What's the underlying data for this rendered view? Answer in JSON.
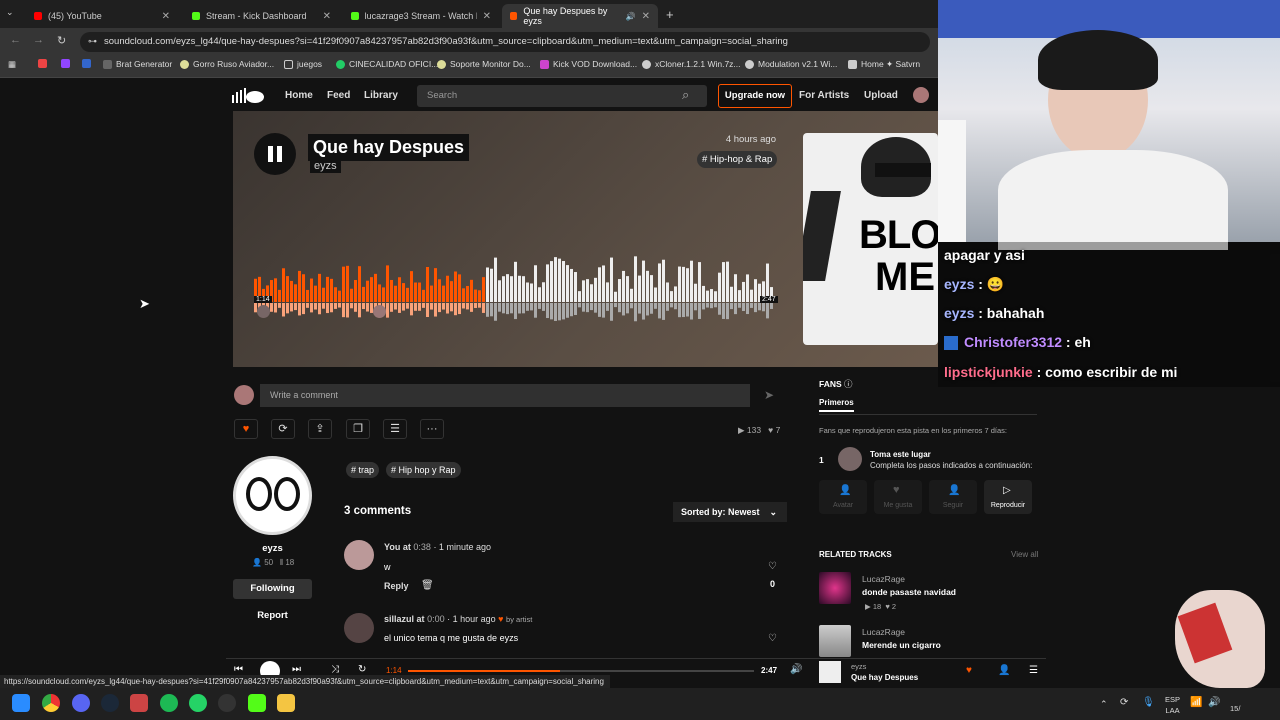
{
  "browser": {
    "tabs": [
      {
        "label": "(45) YouTube"
      },
      {
        "label": "Stream - Kick Dashboard"
      },
      {
        "label": "lucazrage3 Stream - Watch Live"
      },
      {
        "label": "Que hay Despues by eyzs"
      }
    ],
    "url": "soundcloud.com/eyzs_lg44/que-hay-despues?si=41f29f0907a84237957ab82d3f90a93f&utm_source=clipboard&utm_medium=text&utm_campaign=social_sharing",
    "bookmarks": [
      "Brat Generator",
      "Gorro Ruso Aviador...",
      "juegos",
      "CINECALIDAD OFICI...",
      "Soporte Monitor Do...",
      "Kick VOD Download...",
      "xCloner.1.2.1 Win.7z...",
      "Modulation v2.1 Wi...",
      "Home ✦ Satvrn"
    ],
    "status_url": "https://soundcloud.com/eyzs_lg44/que-hay-despues?si=41f29f0907a84237957ab82d3f90a93f&utm_source=clipboard&utm_medium=text&utm_campaign=social_sharing"
  },
  "nav": {
    "home": "Home",
    "feed": "Feed",
    "library": "Library",
    "search_placeholder": "Search",
    "upgrade": "Upgrade now",
    "for_artists": "For Artists",
    "upload": "Upload"
  },
  "track": {
    "title": "Que hay Despues",
    "artist": "eyzs",
    "posted": "4 hours ago",
    "genre": "# Hip-hop & Rap",
    "elapsed": "1:14",
    "duration": "2:47",
    "progress": 0.44,
    "plays": "133",
    "likes": "7"
  },
  "artwork": {
    "text1": "BLOW",
    "text2": "ME"
  },
  "comment_input": {
    "placeholder": "Write a comment"
  },
  "artist_card": {
    "name": "eyzs",
    "followers": "50",
    "tracks": "18",
    "following_btn": "Following",
    "report": "Report"
  },
  "tags": [
    "# trap",
    "# Hip hop y Rap"
  ],
  "comments": {
    "count_label": "3 comments",
    "sort_label": "Sorted by: Newest",
    "items": [
      {
        "user": "You",
        "at": "at",
        "time": "0:38",
        "ago": "· 1 minute ago",
        "text": "w",
        "reply": "Reply",
        "likes": "0",
        "by_artist": ""
      },
      {
        "user": "sillazul",
        "at": "at",
        "time": "0:00",
        "ago": "· 1 hour ago",
        "text": "el unico tema q me gusta de eyzs",
        "reply": "Reply",
        "likes": "1",
        "by_artist": "by artist"
      }
    ]
  },
  "fans": {
    "title": "FANS",
    "tab": "Primeros",
    "desc": "Fans que reprodujeron esta pista en los primeros 7 días:",
    "rank": "1",
    "slot_title": "Toma este lugar",
    "slot_desc": "Completa los pasos indicados a continuación:",
    "steps": [
      "Avatar",
      "Me gusta",
      "Seguir",
      "Reproducir"
    ]
  },
  "related": {
    "title": "RELATED TRACKS",
    "view_all": "View all",
    "items": [
      {
        "artist": "LucazRage",
        "title": "donde pasaste navidad",
        "plays": "18",
        "likes": "2"
      },
      {
        "artist": "LucazRage",
        "title": "Merende un cigarro"
      }
    ]
  },
  "player": {
    "elapsed": "1:14",
    "duration": "2:47",
    "artist": "eyzs",
    "title": "Que hay Despues"
  },
  "chat": [
    {
      "user": "",
      "msg": "apagar y asi",
      "color": "#ffffff"
    },
    {
      "user": "eyzs",
      "msg": " : 😀",
      "color": "#a7b6ff"
    },
    {
      "user": "eyzs",
      "msg": " : bahahah",
      "color": "#a7b6ff"
    },
    {
      "user": "Christofer3312",
      "msg": " : eh",
      "color": "#c08cff"
    },
    {
      "user": "lipstickjunkie",
      "msg": " : como escribir de mi",
      "color": "#ff6d8c"
    }
  ],
  "taskbar": {
    "lang1": "ESP",
    "lang2": "LAA",
    "date": "15/"
  },
  "colors": {
    "accent": "#ff5500",
    "bg": "#121212"
  }
}
